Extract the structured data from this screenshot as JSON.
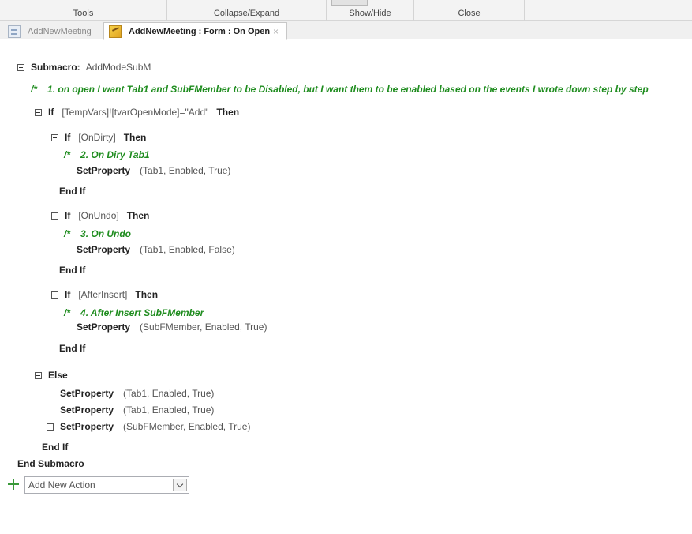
{
  "ribbon": {
    "groups": [
      "Tools",
      "Collapse/Expand",
      "Show/Hide",
      "Close"
    ]
  },
  "tabs": [
    {
      "label": "AddNewMeeting",
      "icon": "form-icon",
      "active": false
    },
    {
      "label": "AddNewMeeting : Form : On Open",
      "icon": "macro-icon",
      "active": true
    }
  ],
  "macro": {
    "submacro_keyword": "Submacro:",
    "submacro_name": "AddModeSubM",
    "comment_marker": "/*",
    "top_comment": "1. on open I want Tab1 and SubFMember to be Disabled, but I want them to be enabled based on the events I wrote down step by step",
    "if_keyword": "If",
    "then_keyword": "Then",
    "outer_if_condition": "[TempVars]![tvarOpenMode]=\"Add\"",
    "inner_blocks": [
      {
        "condition": "[OnDirty]",
        "comment": "2. On Diry Tab1",
        "action": "SetProperty",
        "args": "(Tab1, Enabled, True)"
      },
      {
        "condition": "[OnUndo]",
        "comment": "3. On Undo",
        "action": "SetProperty",
        "args": "(Tab1, Enabled, False)"
      },
      {
        "condition": "[AfterInsert]",
        "comment": "4. After Insert SubFMember",
        "action": "SetProperty",
        "args": "(SubFMember, Enabled, True)"
      }
    ],
    "end_if": "End If",
    "else_keyword": "Else",
    "else_actions": [
      {
        "action": "SetProperty",
        "args": "(Tab1, Enabled, True)"
      },
      {
        "action": "SetProperty",
        "args": "(Tab1, Enabled, True)"
      },
      {
        "action": "SetProperty",
        "args": "(SubFMember, Enabled, True)"
      }
    ],
    "end_submacro": "End Submacro"
  },
  "add_action": {
    "placeholder": "Add New Action"
  },
  "colors": {
    "comment_green": "#1e8c1e",
    "add_plus_green": "#3a9a3a"
  }
}
